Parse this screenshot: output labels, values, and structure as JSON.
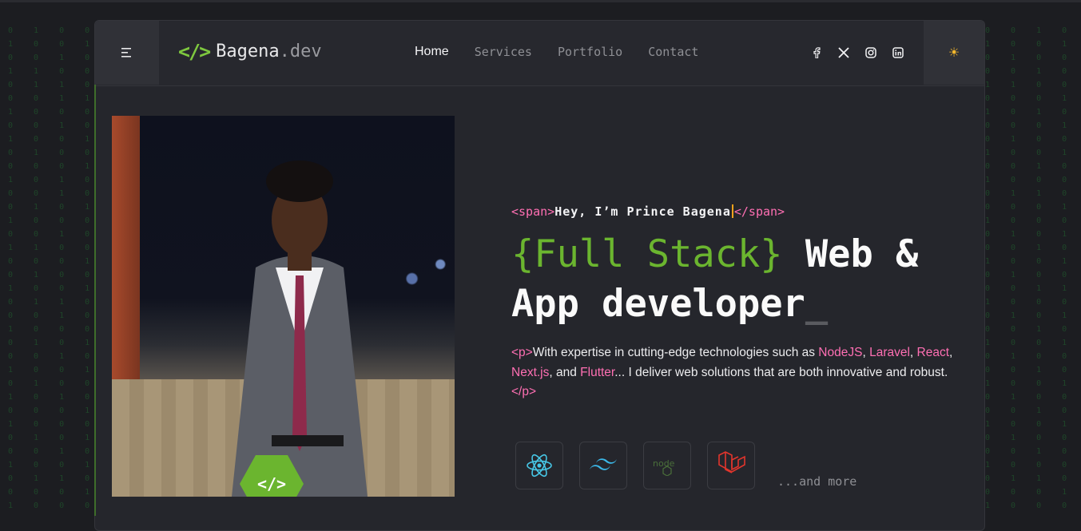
{
  "brand": {
    "mark": "</>",
    "name": "Bagena",
    "tld": ".dev"
  },
  "nav": {
    "home": "Home",
    "services": "Services",
    "portfolio": "Portfolio",
    "contact": "Contact"
  },
  "socials": [
    "facebook-icon",
    "x-icon",
    "instagram-icon",
    "linkedin-icon"
  ],
  "theme_toggle": {
    "icon": "sun-icon",
    "glyph": "☀"
  },
  "hero": {
    "greet_open": "<span>",
    "greet_text": "Hey, I’m Prince Bagena",
    "greet_close": "</span>",
    "title_accent": "{Full Stack}",
    "title_rest_1": " Web &",
    "title_rest_2": "App developer",
    "title_cursor": "_",
    "desc_open": "<p>",
    "desc_1": "With expertise in cutting-edge technologies such as ",
    "tech_nodejs": "NodeJS",
    "sep_1": ", ",
    "tech_laravel": "Laravel",
    "sep_2": ",",
    "tech_react": "React",
    "sep_3": ", ",
    "tech_next": "Next.js",
    "sep_4": ", and ",
    "tech_flutter": "Flutter",
    "desc_2": "... I deliver web solutions that are both innovative and robust.",
    "desc_close": "</p>",
    "badge": "</>"
  },
  "techs": [
    "react-icon",
    "tailwind-icon",
    "nodejs-icon",
    "laravel-icon"
  ],
  "more": "...and more",
  "colors": {
    "accent": "#6bb52f",
    "tag": "#ff6fb3",
    "bg": "#25262c"
  },
  "matrix": {
    "left": "0 1 0 0 1 1\n1 0 0 1 0 0\n0 0 1 0 1 0\n1 1 0 0 0 1\n0 1 1 0 0 0\n0 0 1 1 0 1\n1 0 0 0 1 0\n0 0 1 0 0 0\n1 0 0 1 1 0\n0 1 0 0 1 0\n0 0 0 1 0 1\n1 0 1 0 0 0\n0 0 1 0 1 0\n0 1 0 1 0 0\n1 0 0 0 0 1\n0 0 1 0 1 0\n1 1 0 0 0 1\n0 0 0 1 0 0\n0 1 0 0 1 0\n1 0 0 1 0 0\n0 1 1 0 0 1\n0 0 1 0 1 0\n1 0 0 0 1 0\n0 1 0 1 0 0\n0 0 1 0 0 1\n1 0 0 1 0 0\n0 1 0 0 1 0\n1 0 1 0 0 1\n0 0 0 1 1 0\n1 0 0 0 0 1\n0 1 0 1 0 0\n0 0 1 0 1 0\n1 0 0 1 0 0\n0 1 1 0 0 1\n0 0 0 1 0 1\n1 0 0 0 1 0",
    "right": "0 0 1 0 0 1\n1 0 0 1 0 0\n0 1 0 0 1 0\n0 0 1 0 0 0\n1 1 0 0 1 0\n0 0 0 1 0 1\n1 0 1 0 0 0\n0 0 0 1 1 0\n0 1 0 0 0 1\n1 0 0 1 0 0\n0 0 1 0 1 0\n1 0 0 0 0 1\n0 1 1 0 0 0\n0 0 0 1 0 1\n1 0 0 0 1 0\n0 1 0 1 0 0\n0 0 1 0 0 1\n1 0 0 1 0 0\n0 1 0 0 1 0\n0 0 1 1 0 0\n1 0 0 0 1 1\n0 1 0 1 0 0\n0 0 1 0 0 1\n1 0 0 1 0 0\n0 1 0 0 1 0\n0 0 1 0 0 1\n1 0 0 1 1 0\n0 1 0 0 0 1\n0 0 1 0 1 0\n1 0 0 1 0 0\n0 1 0 0 1 0\n0 0 1 0 0 1\n1 0 0 0 1 0\n0 1 1 0 0 0\n0 0 0 1 0 1\n1 0 0 0 1 0"
  }
}
